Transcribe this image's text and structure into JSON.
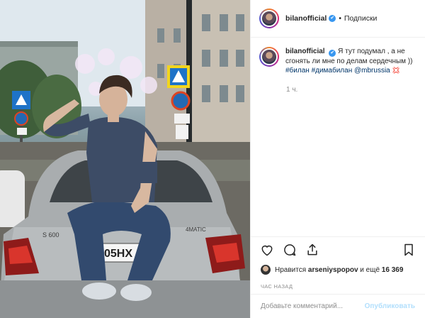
{
  "post": {
    "username": "bilanofficial",
    "verified_mark": "✔",
    "follow_separator": "•",
    "follow_label": "Подписки",
    "caption_username": "bilanofficial",
    "caption_text": "Я тут подумал , а не сгонять ли мне по делам сердечным ))",
    "hashtags": [
      "#билан",
      "#димабилан",
      "@mbrussia"
    ],
    "caption_emoji": "💢",
    "time_short": "1 ч.",
    "liked_by_prefix": "Нравится",
    "liked_by_user": "arseniyspopov",
    "liked_by_conj": "и ещё",
    "likes_count": "16 369",
    "time_ago": "час назад",
    "comment_placeholder": "Добавьте комментарий...",
    "publish_label": "Опубликовать"
  },
  "photo": {
    "plate": "05НХ",
    "model_badge": "S 600",
    "drive_badge": "4MATIC"
  },
  "icons": {
    "like": "heart-icon",
    "comment": "comment-icon",
    "share": "share-icon",
    "save": "bookmark-icon"
  },
  "colors": {
    "verified": "#3897f0",
    "hashtag": "#003569",
    "publish": "#b2dffc",
    "muted": "#8e8e8e"
  }
}
